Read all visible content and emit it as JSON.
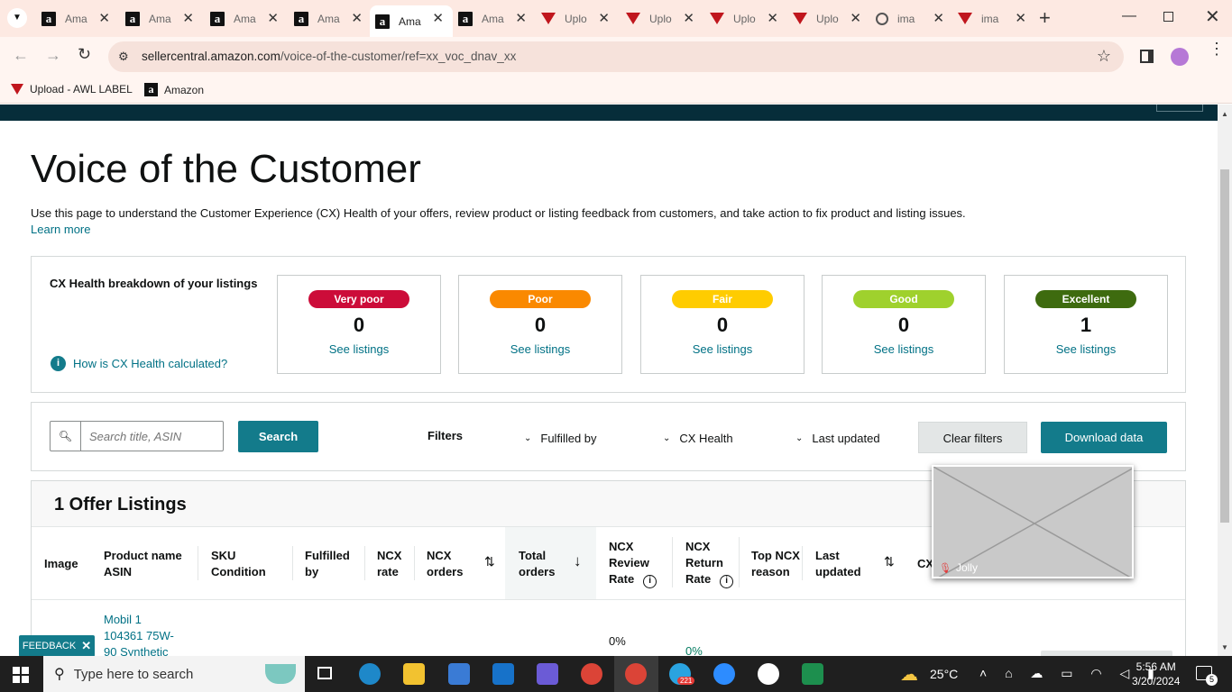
{
  "browser": {
    "tabs": [
      {
        "title": "Ama",
        "icon": "amazon-icon"
      },
      {
        "title": "Ama",
        "icon": "amazon-icon"
      },
      {
        "title": "Ama",
        "icon": "amazon-icon"
      },
      {
        "title": "Ama",
        "icon": "amazon-icon"
      },
      {
        "title": "Ama",
        "icon": "amazon-icon",
        "active": true
      },
      {
        "title": "Ama",
        "icon": "amazon-icon"
      },
      {
        "title": "Uplo",
        "icon": "awl-icon"
      },
      {
        "title": "Uplo",
        "icon": "awl-icon"
      },
      {
        "title": "Uplo",
        "icon": "awl-icon"
      },
      {
        "title": "Uplo",
        "icon": "awl-icon"
      },
      {
        "title": "ima",
        "icon": "image-icon"
      },
      {
        "title": "ima",
        "icon": "awl-icon"
      }
    ],
    "url_host": "sellercentral.amazon.com",
    "url_path": "/voice-of-the-customer/ref=xx_voc_dnav_xx",
    "bookmarks": [
      {
        "label": "Upload - AWL LABEL"
      },
      {
        "label": "Amazon"
      }
    ]
  },
  "page": {
    "title": "Voice of the Customer",
    "description": "Use this page to understand the Customer Experience (CX) Health of your offers, review product or listing feedback from customers, and take action to fix product and listing issues.",
    "learn_more": "Learn more",
    "cx_health": {
      "heading": "CX Health breakdown of your listings",
      "info_link": "How is CX Health calculated?",
      "cards": [
        {
          "label": "Very poor",
          "count": "0",
          "link": "See listings",
          "color": "#cc0c39",
          "text_color": "#ffffff"
        },
        {
          "label": "Poor",
          "count": "0",
          "link": "See listings",
          "color": "#fa8900",
          "text_color": "#ffffff"
        },
        {
          "label": "Fair",
          "count": "0",
          "link": "See listings",
          "color": "#ffcc00",
          "text_color": "#ffffff"
        },
        {
          "label": "Good",
          "count": "0",
          "link": "See listings",
          "color": "#9fd12d",
          "text_color": "#ffffff"
        },
        {
          "label": "Excellent",
          "count": "1",
          "link": "See listings",
          "color": "#3e6b0f",
          "text_color": "#ffffff"
        }
      ]
    },
    "filters": {
      "search_placeholder": "Search title, ASIN",
      "search_button": "Search",
      "filters_label": "Filters",
      "dropdowns": [
        "Fulfilled by",
        "CX Health",
        "Last updated"
      ],
      "clear_button": "Clear filters",
      "download_button": "Download data"
    },
    "listings": {
      "heading": "1 Offer Listings",
      "columns": {
        "image": "Image",
        "product_1": "Product name",
        "product_2": "ASIN",
        "sku_1": "SKU",
        "sku_2": "Condition",
        "fulfilled_1": "Fulfilled",
        "fulfilled_2": "by",
        "ncx_rate_1": "NCX",
        "ncx_rate_2": "rate",
        "ncx_orders_1": "NCX",
        "ncx_orders_2": "orders",
        "total_1": "Total",
        "total_2": "orders",
        "review_1": "NCX",
        "review_2": "Review",
        "review_3": "Rate",
        "return_1": "NCX",
        "return_2": "Return",
        "return_3": "Rate",
        "top_1": "Top NCX",
        "top_2": "reason",
        "last_1": "Last",
        "last_2": "updated",
        "cx": "CX"
      },
      "row": {
        "product_1": "Mobil 1",
        "product_2": "104361 75W-",
        "product_3": "90 Synthetic",
        "review_rate": "0%",
        "return_rate": "0%"
      }
    },
    "feedback": "FEEDBACK",
    "video_name": "Jolly"
  },
  "taskbar": {
    "search_placeholder": "Type here to search",
    "weather": "25°C",
    "time": "5:56 AM",
    "date": "3/20/2024",
    "telegram_badge": "221",
    "notifications": "5"
  }
}
